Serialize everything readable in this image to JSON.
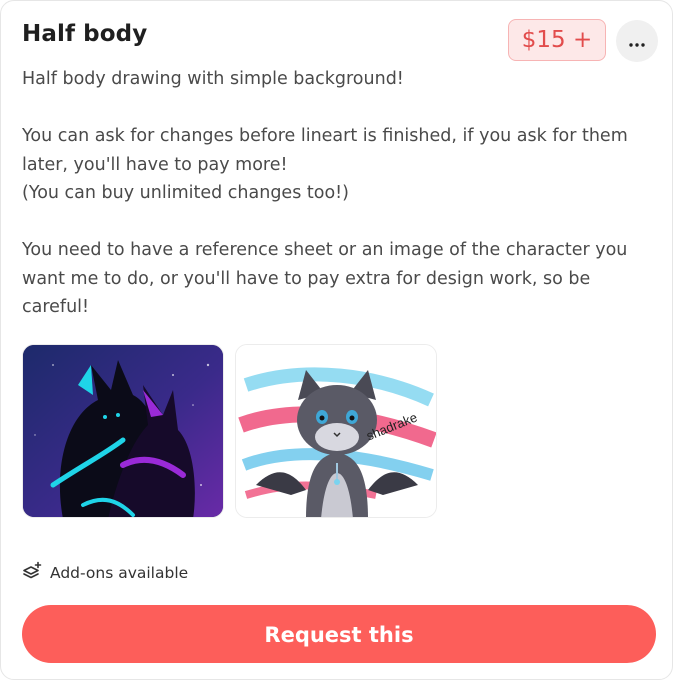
{
  "item": {
    "title": "Half body",
    "price": "$15 +",
    "description": [
      "Half body drawing with simple background!",
      "You can ask for changes before lineart is finished, if you ask for them later, you'll have to pay more!\n(You can buy unlimited changes too!)",
      "You need to have a reference sheet or an image of the character you want me to do, or you'll have to pay extra for design work, so be careful!"
    ],
    "thumbnails": [
      {
        "icon": "example-artwork-dark-characters"
      },
      {
        "icon": "example-artwork-cat-dragon",
        "signature": "shadrake"
      }
    ],
    "addons_label": "Add-ons available",
    "request_label": "Request this"
  },
  "colors": {
    "accent": "#fd5e5a",
    "price_bg": "#fde8e8",
    "price_text": "#e24c4c"
  },
  "icons": {
    "more": "more-options-icon",
    "addons": "layers-plus-icon"
  }
}
